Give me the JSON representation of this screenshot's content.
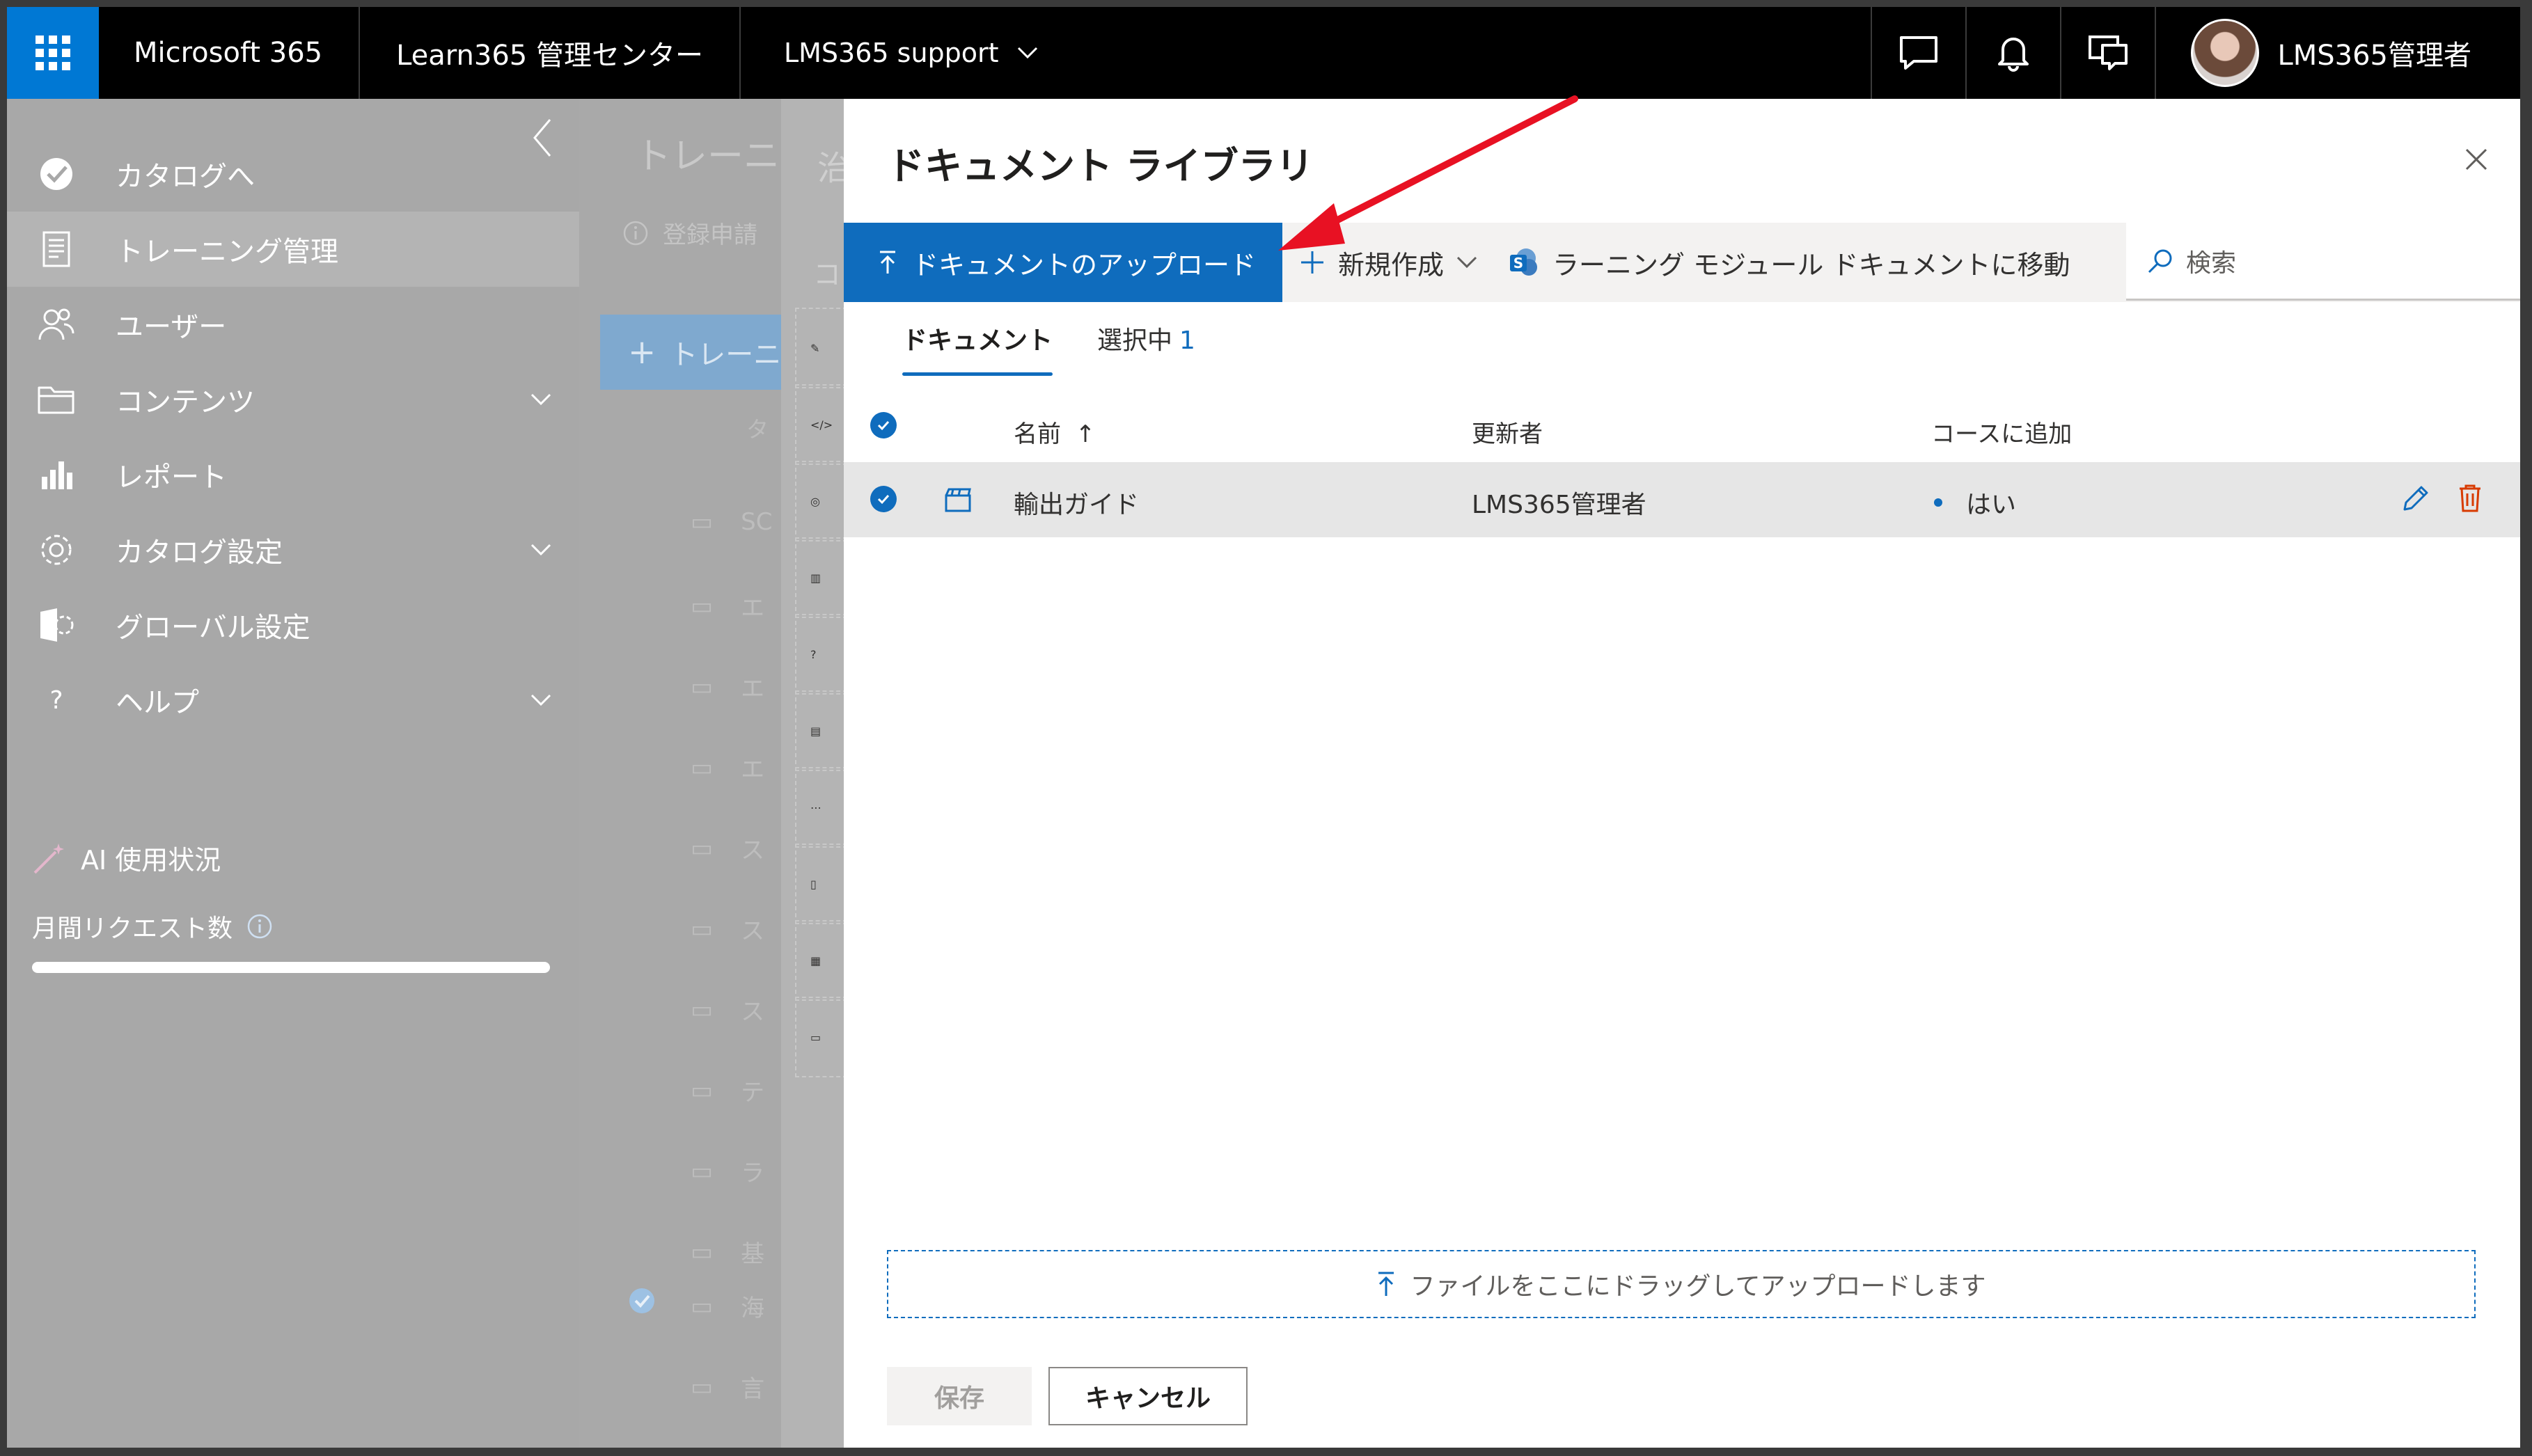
{
  "topbar": {
    "brand": "Microsoft 365",
    "app": "Learn365 管理センター",
    "org": "LMS365 support",
    "user": "LMS365管理者"
  },
  "leftnav": {
    "items": [
      {
        "label": "カタログへ",
        "icon": "catalog-check-icon"
      },
      {
        "label": "トレーニング管理",
        "icon": "training-doc-icon",
        "active": true
      },
      {
        "label": "ユーザー",
        "icon": "users-icon"
      },
      {
        "label": "コンテンツ",
        "icon": "folder-icon",
        "expandable": true
      },
      {
        "label": "レポート",
        "icon": "report-bars-icon"
      },
      {
        "label": "カタログ設定",
        "icon": "gear-icon",
        "expandable": true
      },
      {
        "label": "グローバル設定",
        "icon": "global-settings-icon"
      },
      {
        "label": "ヘルプ",
        "icon": "help-icon",
        "expandable": true
      }
    ],
    "ai_title": "AI 使用状況",
    "ai_monthly_requests": "月間リクエスト数"
  },
  "background_page": {
    "title": "トレーニ",
    "info": "登録申請",
    "new_button": "トレーニ",
    "column": "タ",
    "rows": [
      "SC",
      "エ",
      "エ",
      "エ",
      "ス",
      "ス",
      "ス",
      "テ",
      "ラ",
      "基",
      "海",
      "言"
    ]
  },
  "panel2": {
    "title": "治",
    "label": "コ"
  },
  "modal": {
    "title": "ドキュメント ライブラリ",
    "toolbar": {
      "upload_label": "ドキュメントのアップロード",
      "new_label": "新規作成",
      "move_label": "ラーニング モジュール ドキュメントに移動",
      "search_placeholder": "検索"
    },
    "tabs": {
      "documents": "ドキュメント",
      "selected": "選択中",
      "selected_count": "1"
    },
    "table": {
      "headers": {
        "name": "名前",
        "sort": "↑",
        "modified_by": "更新者",
        "added_to_course": "コースに追加"
      },
      "rows": [
        {
          "name": "輸出ガイド",
          "modified_by": "LMS365管理者",
          "added_to_course": "はい",
          "selected": true
        }
      ]
    },
    "dropzone": "ファイルをここにドラッグしてアップロードします",
    "save_label": "保存",
    "cancel_label": "キャンセル"
  },
  "colors": {
    "accent": "#0f6cbd",
    "annotation_arrow": "#e81123",
    "delete": "#d83b01"
  }
}
